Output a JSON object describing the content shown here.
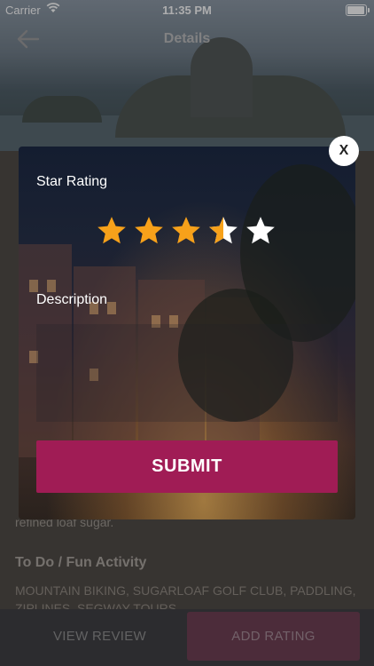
{
  "status_bar": {
    "carrier": "Carrier",
    "time": "11:35 PM"
  },
  "nav": {
    "title": "Details"
  },
  "background": {
    "description_end": "refined loaf sugar.",
    "section_heading": "To Do / Fun Activity",
    "activities": "MOUNTAIN BIKING, SUGARLOAF GOLF CLUB, PADDLING, ZIPLINES, SEGWAY TOURS"
  },
  "bottom_bar": {
    "view_review_label": "VIEW REVIEW",
    "add_rating_label": "ADD RATING"
  },
  "modal": {
    "close_label": "X",
    "star_rating_label": "Star Rating",
    "rating_value": 3.5,
    "rating_max": 5,
    "description_label": "Description",
    "description_value": "",
    "submit_label": "SUBMIT",
    "colors": {
      "star_filled": "#f7a11a",
      "star_empty": "#ffffff",
      "submit": "#a01c55"
    }
  }
}
